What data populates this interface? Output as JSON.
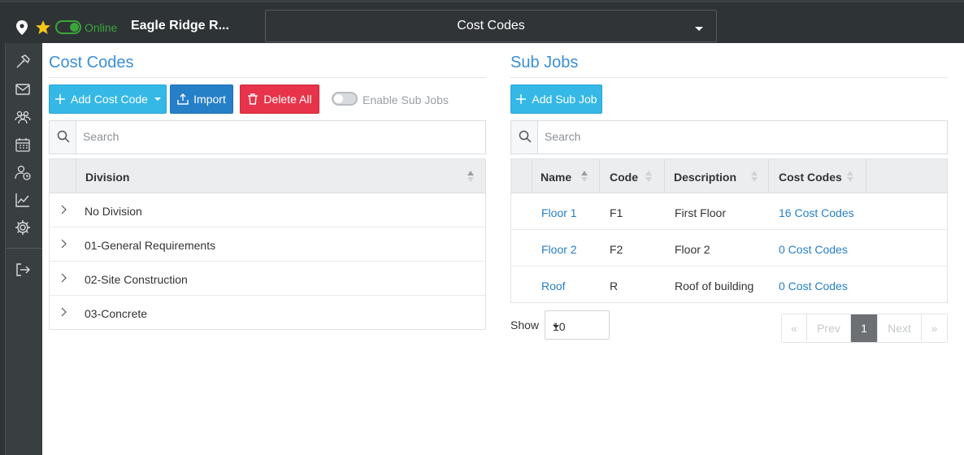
{
  "topbar": {
    "status": "Online",
    "project": "Eagle Ridge R...",
    "module_select": "Cost Codes"
  },
  "sidebar": {
    "icons": [
      "hammer-icon",
      "mail-icon",
      "users-icon",
      "calendar-icon",
      "user-clock-icon",
      "chart-icon",
      "gear-icon",
      "logout-icon"
    ]
  },
  "cost_codes": {
    "title": "Cost Codes",
    "add_button": "Add Cost Code",
    "import_button": "Import",
    "delete_button": "Delete All",
    "enable_sub_jobs": "Enable Sub Jobs",
    "search_placeholder": "Search",
    "column_division": "Division",
    "divisions": [
      "No Division",
      "01-General Requirements",
      "02-Site Construction",
      "03-Concrete"
    ]
  },
  "sub_jobs": {
    "title": "Sub Jobs",
    "add_button": "Add Sub Job",
    "search_placeholder": "Search",
    "columns": [
      "Name",
      "Code",
      "Description",
      "Cost Codes"
    ],
    "rows": [
      {
        "name": "Floor 1",
        "code": "F1",
        "description": "First Floor",
        "cost_codes": "16 Cost Codes"
      },
      {
        "name": "Floor 2",
        "code": "F2",
        "description": "Floor 2",
        "cost_codes": "0 Cost Codes"
      },
      {
        "name": "Roof",
        "code": "R",
        "description": "Roof of building",
        "cost_codes": "0 Cost Codes"
      }
    ],
    "show_label": "Show",
    "page_size": "10",
    "pager": {
      "first": "«",
      "prev": "Prev",
      "current": "1",
      "next": "Next",
      "last": "»"
    }
  },
  "colors": {
    "accent_blue": "#3a8fd6",
    "online_green": "#3aa63a",
    "danger_red": "#e7344a",
    "info_cyan": "#35b8e6"
  }
}
